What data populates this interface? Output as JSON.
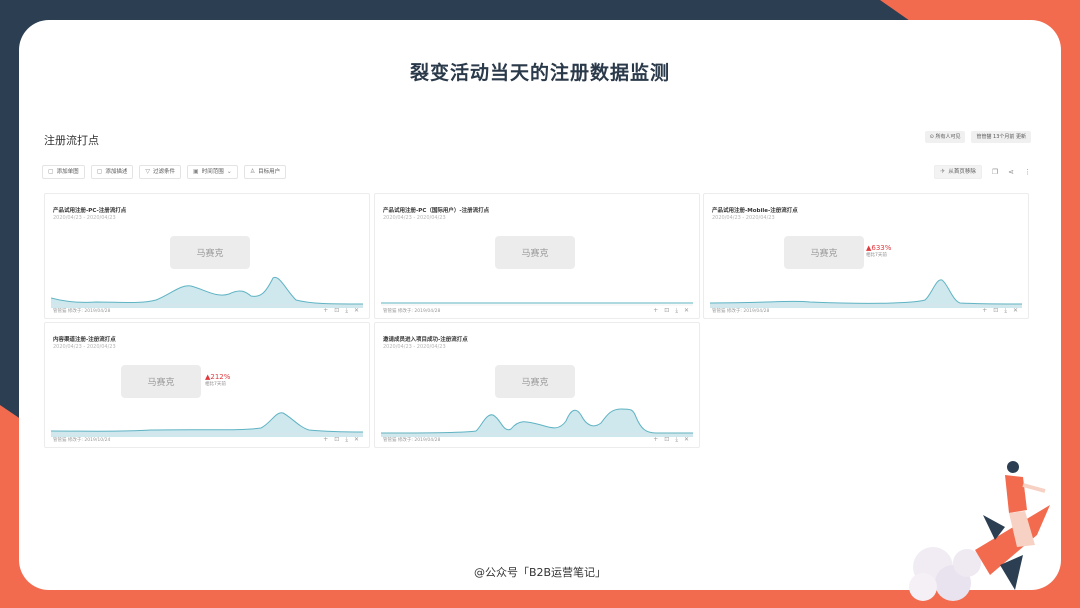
{
  "slide": {
    "title": "裂变活动当天的注册数据监测",
    "credit": "@公众号「B2B运营笔记」"
  },
  "dashboard": {
    "title": "注册流打点",
    "visibility": "所有人可见",
    "update_note": "管管猫 13个月前 更新",
    "toolbar": [
      {
        "icon": "file-icon",
        "label": "添加单图"
      },
      {
        "icon": "file-icon",
        "label": "添加描述"
      },
      {
        "icon": "filter-icon",
        "label": "过滤条件"
      },
      {
        "icon": "calendar-icon",
        "label": "时间范围"
      },
      {
        "icon": "user-icon",
        "label": "目标用户"
      }
    ],
    "right_action": "从首页移除"
  },
  "cards": [
    {
      "title": "产品试用注册-PC-注册流打点",
      "dates": "2020/04/23 - 2020/04/23",
      "placeholder": "马赛克",
      "footer": "管管猫 修改于: 2019/04/28"
    },
    {
      "title": "产品试用注册-PC（国际用户）-注册流打点",
      "dates": "2020/04/23 - 2020/04/23",
      "placeholder": "马赛克",
      "footer": "管管猫 修改于: 2019/04/28"
    },
    {
      "title": "产品试用注册-Mobile-注册流打点",
      "dates": "2020/04/23 - 2020/04/23",
      "placeholder": "马赛克",
      "footer": "管管猫 修改于: 2019/04/28",
      "delta": "▲633%",
      "delta_note": "相比7天前"
    },
    {
      "title": "内容渠道注册-注册流打点",
      "dates": "2020/04/23 - 2020/04/23",
      "placeholder": "马赛克",
      "footer": "管管猫 修改于: 2019/10/24",
      "delta": "▲212%",
      "delta_note": "相比7天前"
    },
    {
      "title": "邀请成员进入项目成功-注册流打点",
      "dates": "2020/04/23 - 2020/04/23",
      "placeholder": "马赛克",
      "footer": "管管猫 修改于: 2019/04/28"
    }
  ],
  "colors": {
    "accent": "#f26b4f",
    "dark": "#2c3f52",
    "spark": "#5fb3c3"
  }
}
